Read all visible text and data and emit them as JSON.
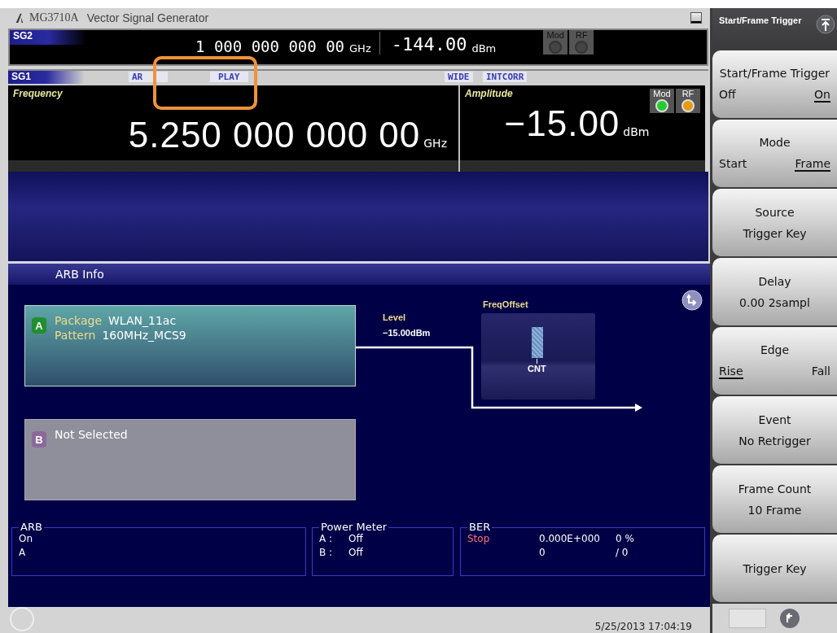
{
  "window": {
    "title": "MG3710A",
    "subtitle": "Vector Signal Generator"
  },
  "sg2": {
    "label": "SG2",
    "frequency": "1 000 000 000 00",
    "frequency_unit": "GHz",
    "amplitude": "-144.00",
    "amplitude_unit": "dBm",
    "indicators": [
      {
        "label": "Mod",
        "on": false
      },
      {
        "label": "RF",
        "on": false
      }
    ]
  },
  "sg1": {
    "label": "SG1",
    "tags": [
      "AR",
      "PLAY",
      "WIDE",
      "INTCORR"
    ],
    "frequency_label": "Frequency",
    "frequency": "5.250 000 000 00",
    "frequency_unit": "GHz",
    "amplitude_label": "Amplitude",
    "amplitude": "−15.00",
    "amplitude_unit": "dBm",
    "indicators": [
      {
        "label": "Mod",
        "on": true,
        "color": "#22cc33"
      },
      {
        "label": "RF",
        "on": true,
        "color": "#e89a10"
      }
    ]
  },
  "arb_info": {
    "title": "ARB Info",
    "memories": [
      {
        "letter": "A",
        "selected": true,
        "color": "#1f8f2f",
        "lines": [
          {
            "key": "Package",
            "value": "WLAN_11ac"
          },
          {
            "key": "Pattern",
            "value": "160MHz_MCS9"
          }
        ]
      },
      {
        "letter": "B",
        "selected": false,
        "color": "#8a6a9a",
        "text": "Not Selected"
      }
    ],
    "level_label": "Level",
    "level_value": "−15.00dBm",
    "freq_offset_label": "FreqOffset",
    "freq_offset_marker": "CNT"
  },
  "summary": [
    {
      "title": "ARB",
      "lines": [
        [
          "On"
        ],
        [
          "A"
        ]
      ]
    },
    {
      "title": "Power Meter",
      "lines": [
        [
          "A :",
          "Off"
        ],
        [
          "B :",
          "Off"
        ]
      ]
    },
    {
      "title": "BER",
      "lines": [
        [
          "Stop",
          "0.000E+000",
          "0 %"
        ],
        [
          "0",
          "/ 0"
        ]
      ]
    }
  ],
  "status_bar": {
    "datetime": "5/25/2013 17:04:19"
  },
  "menu": {
    "title": "Start/Frame Trigger",
    "softkeys": [
      {
        "kind": "toggle",
        "label": "Start/Frame Trigger",
        "options": [
          {
            "label": "Off",
            "selected": false
          },
          {
            "label": "On",
            "selected": true
          }
        ]
      },
      {
        "kind": "toggle",
        "label": "Mode",
        "options": [
          {
            "label": "Start",
            "selected": false
          },
          {
            "label": "Frame",
            "selected": true
          }
        ]
      },
      {
        "kind": "value",
        "label": "Source",
        "value": "Trigger Key"
      },
      {
        "kind": "value",
        "label": "Delay",
        "value": "0.00  2sampl"
      },
      {
        "kind": "toggle",
        "label": "Edge",
        "options": [
          {
            "label": "Rise",
            "selected": true
          },
          {
            "label": "Fall",
            "selected": false
          }
        ]
      },
      {
        "kind": "value",
        "label": "Event",
        "value": "No Retrigger"
      },
      {
        "kind": "value",
        "label": "Frame Count",
        "value": "10 Frame"
      },
      {
        "kind": "plain",
        "label": "Trigger Key"
      }
    ]
  }
}
